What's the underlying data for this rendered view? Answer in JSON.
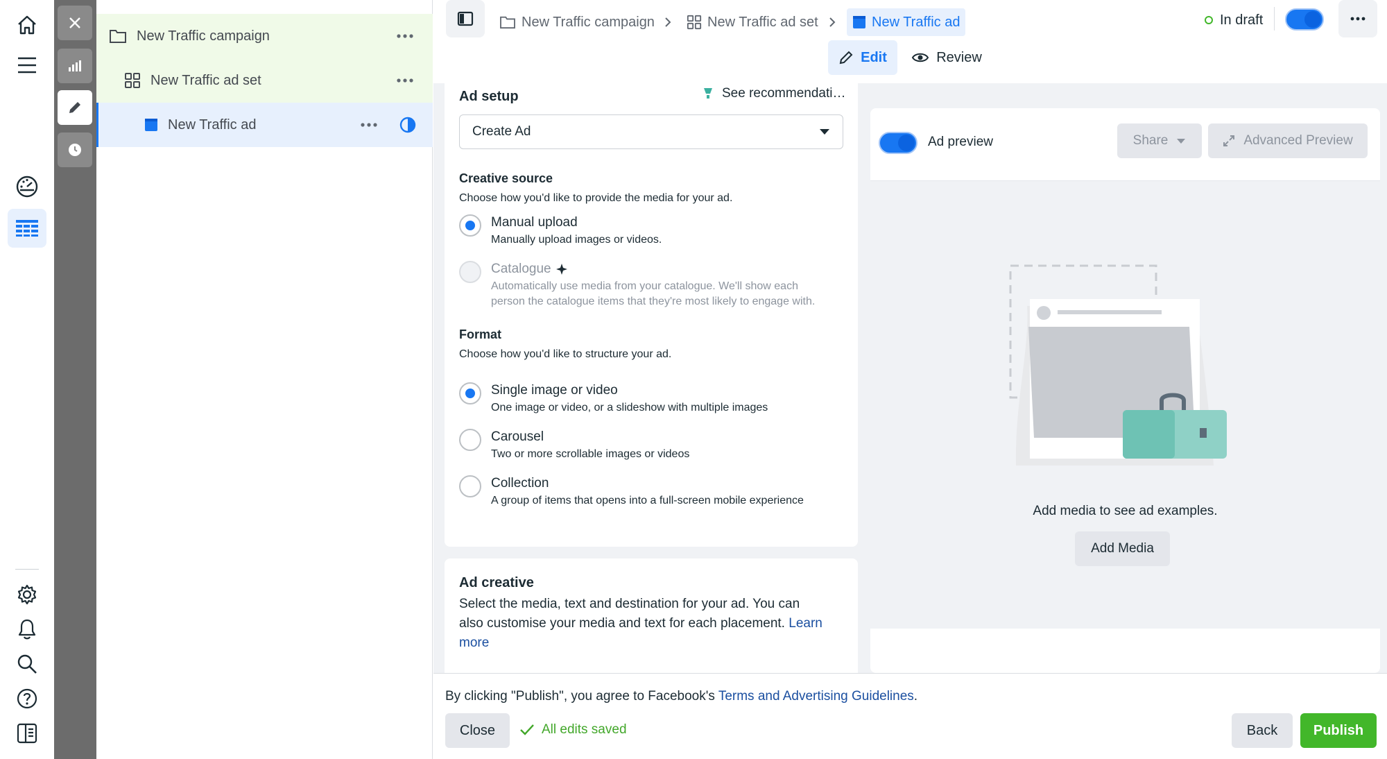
{
  "colors": {
    "accent": "#1877f2",
    "publish": "#42b72a",
    "success": "#42a72a",
    "selected_row": "#e7f0fd",
    "campaign_row": "#f0fae8"
  },
  "leftnav": {
    "top_icons": [
      "home-icon",
      "menu-icon",
      "dashboard-icon",
      "table-icon"
    ],
    "bottom_icons": [
      "settings-icon",
      "notifications-icon",
      "search-icon",
      "help-icon",
      "panel-icon"
    ]
  },
  "tree": {
    "campaign": "New Traffic campaign",
    "adset": "New Traffic ad set",
    "ad": "New Traffic ad"
  },
  "breadcrumb": {
    "campaign": "New Traffic campaign",
    "adset": "New Traffic ad set",
    "ad": "New Traffic ad"
  },
  "status": {
    "label": "In draft"
  },
  "tabs": {
    "edit": "Edit",
    "review": "Review"
  },
  "ad_setup": {
    "title": "Ad setup",
    "recommendations": "See recommendati…",
    "select_value": "Create Ad",
    "creative_source": {
      "title": "Creative source",
      "desc": "Choose how you'd like to provide the media for your ad.",
      "options": [
        {
          "title": "Manual upload",
          "desc": "Manually upload images or videos."
        },
        {
          "title": "Catalogue",
          "desc_line1": "Automatically use media from your catalogue. We'll show each",
          "desc_line2": "person the catalogue items that they're most likely to engage with."
        }
      ]
    },
    "format": {
      "title": "Format",
      "desc": "Choose how you'd like to structure your ad.",
      "options": [
        {
          "title": "Single image or video",
          "desc": "One image or video, or a slideshow with multiple images"
        },
        {
          "title": "Carousel",
          "desc": "Two or more scrollable images or videos"
        },
        {
          "title": "Collection",
          "desc": "A group of items that opens into a full-screen mobile experience"
        }
      ]
    }
  },
  "ad_creative": {
    "title": "Ad creative",
    "desc_line1": "Select the media, text and destination for your ad. You can",
    "desc_line2": "also customise your media and text for each placement.",
    "learn": "Learn",
    "more": "more"
  },
  "preview": {
    "toggle_label": "Ad preview",
    "share": "Share",
    "advanced": "Advanced Preview",
    "empty_text": "Add media to see ad examples.",
    "add_media": "Add Media"
  },
  "footer": {
    "notice_prefix": "By clicking \"Publish\", you agree to Facebook's",
    "notice_link": "Terms and Advertising Guidelines",
    "notice_suffix": ".",
    "close": "Close",
    "saved": "All edits saved",
    "back": "Back",
    "publish": "Publish"
  }
}
